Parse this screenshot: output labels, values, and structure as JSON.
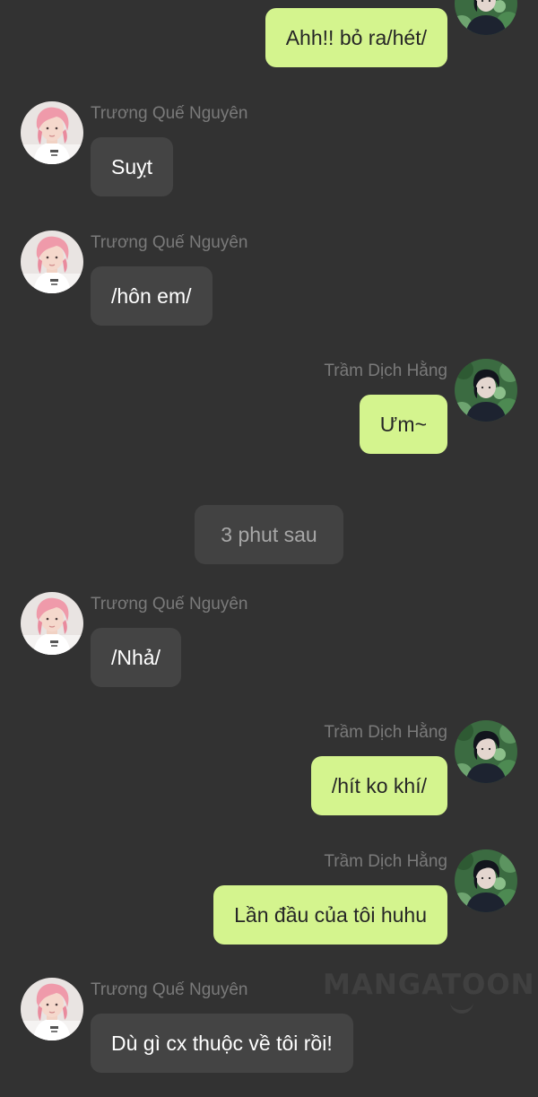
{
  "participants": {
    "left_name": "Trương Quế Nguyên",
    "right_name": "Trầm Dịch Hằng"
  },
  "messages": [
    {
      "side": "right",
      "show_name": false,
      "text": "Ahh!! bỏ ra/hét/"
    },
    {
      "side": "left",
      "name": "Trương Quế Nguyên",
      "text": "Suỵt"
    },
    {
      "side": "left",
      "name": "Trương Quế Nguyên",
      "text": "/hôn em/"
    },
    {
      "side": "right",
      "name": "Trầm Dịch Hằng",
      "text": "Ưm~"
    },
    {
      "side": "system",
      "text": "3 phut sau"
    },
    {
      "side": "left",
      "name": "Trương Quế Nguyên",
      "text": "/Nhả/"
    },
    {
      "side": "right",
      "name": "Trầm Dịch Hằng",
      "text": "/hít ko khí/"
    },
    {
      "side": "right",
      "name": "Trầm Dịch Hằng",
      "text": "Lần đầu của tôi huhu"
    },
    {
      "side": "left",
      "name": "Trương Quế Nguyên",
      "text": "Dù gì cx thuộc về tôi rồi!"
    }
  ],
  "watermark": "MANGATOON",
  "colors": {
    "background": "#323232",
    "left_bubble": "#444444",
    "right_bubble": "#d4f48e",
    "system_bubble": "#424242",
    "name_text": "#7a7a7a"
  },
  "icons": {
    "left_avatar": "avatar-pink-hair-portrait-icon",
    "right_avatar": "avatar-dark-hair-greenery-portrait-icon"
  }
}
